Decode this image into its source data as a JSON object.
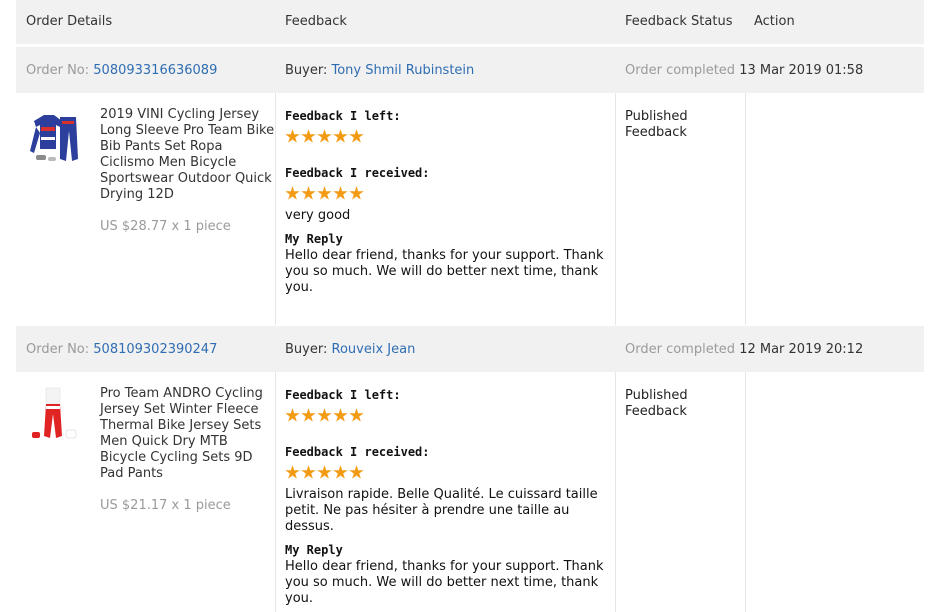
{
  "columns": {
    "order_details": "Order Details",
    "feedback": "Feedback",
    "feedback_status": "Feedback Status",
    "action": "Action"
  },
  "labels": {
    "order_no": "Order No:",
    "buyer": "Buyer:",
    "order_completed": "Order completed",
    "feedback_left": "Feedback I left:",
    "feedback_received": "Feedback I received:",
    "my_reply": "My Reply"
  },
  "colors": {
    "link": "#2f6db3",
    "star": "#f49b16",
    "header_bg": "#f1f1f1",
    "muted": "#9a9a9a"
  },
  "orders": [
    {
      "order_no": "508093316636089",
      "buyer": "Tony Shmil Rubinstein",
      "completed_at": "13 Mar 2019 01:58",
      "product_title": "2019 VINI Cycling Jersey Long Sleeve Pro Team Bike Bib Pants Set Ropa Ciclismo Men Bicycle Sportswear Outdoor Quick Drying 12D",
      "price": "US $28.77 x 1 piece",
      "left_rating": 5,
      "received_rating": 5,
      "received_comment": "very good",
      "reply": "Hello dear friend, thanks for your support. Thank you so much. We will do better next time, thank you.",
      "status": "Published Feedback",
      "thumb_icon": "cycling-jersey-blue-icon"
    },
    {
      "order_no": "508109302390247",
      "buyer": "Rouveix Jean",
      "completed_at": "12 Mar 2019 20:12",
      "product_title": "Pro Team ANDRO Cycling Jersey Set Winter Fleece Thermal Bike Jersey Sets Men Quick Dry MTB Bicycle Cycling Sets 9D Pad Pants",
      "price": "US $21.17 x 1 piece",
      "left_rating": 5,
      "received_rating": 5,
      "received_comment": "Livraison rapide. Belle Qualité. Le cuissard taille petit. Ne pas hésiter à prendre une taille au dessus.",
      "reply": "Hello dear friend, thanks for your support. Thank you so much. We will do better next time, thank you.",
      "status": "Published Feedback",
      "thumb_icon": "cycling-jersey-red-icon"
    }
  ]
}
